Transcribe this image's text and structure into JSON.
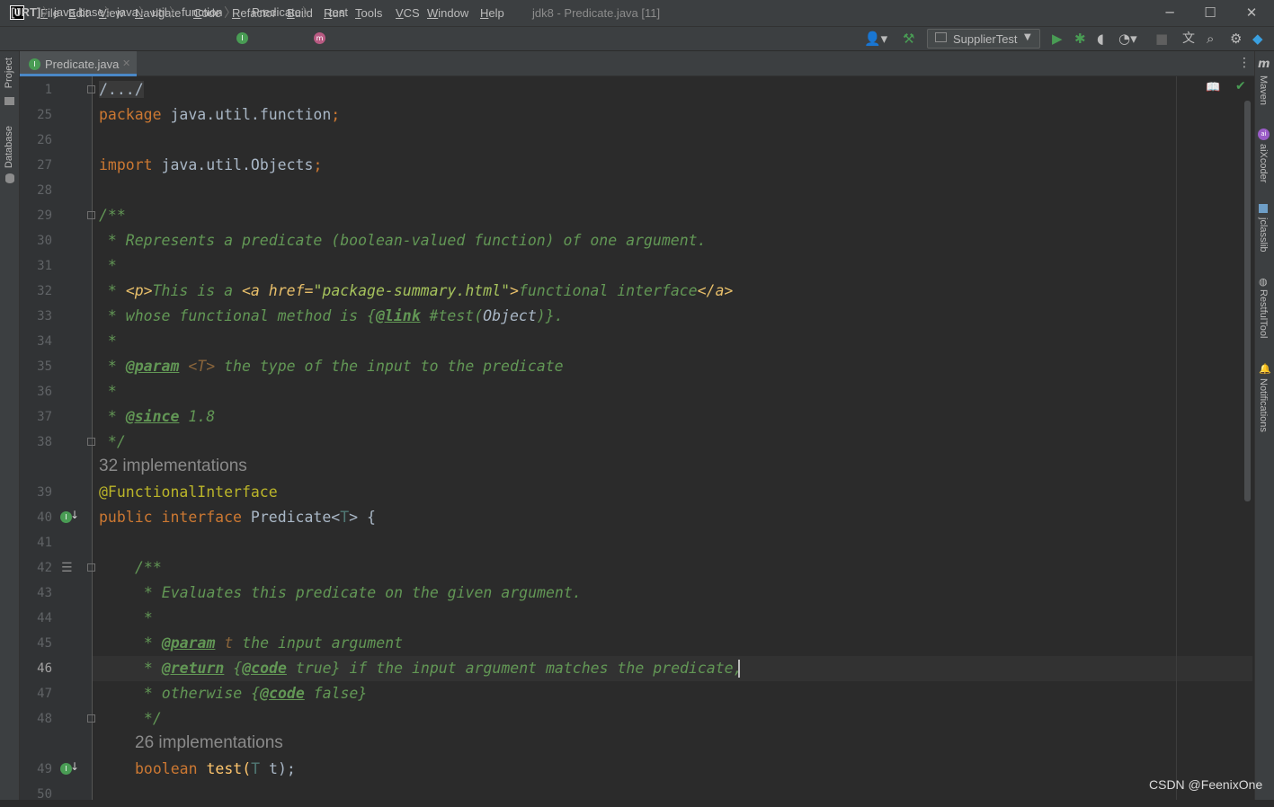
{
  "titlebar": {
    "menus": [
      "File",
      "Edit",
      "View",
      "Navigate",
      "Code",
      "Refactor",
      "Build",
      "Run",
      "Tools",
      "VCS",
      "Window",
      "Help"
    ],
    "window_title": "jdk8 - Predicate.java [11]",
    "minimize": "─",
    "maximize": "☐",
    "close": "✕"
  },
  "navbar": {
    "breadcrumbs": [
      "[JRT]",
      "java.base",
      "java",
      "util",
      "function",
      "Predicate",
      "test"
    ],
    "run_config": "SupplierTest"
  },
  "tool_windows": {
    "left": [
      "Project",
      "Database"
    ],
    "right": [
      "Maven",
      "aiXcoder",
      "jclasslib",
      "RestfulTool",
      "Notifications"
    ]
  },
  "editor": {
    "tab_label": "Predicate.java",
    "line_numbers": [
      "1",
      "25",
      "26",
      "27",
      "28",
      "29",
      "30",
      "31",
      "32",
      "33",
      "34",
      "35",
      "36",
      "37",
      "38",
      "39",
      "40",
      "41",
      "42",
      "43",
      "44",
      "45",
      "46",
      "47",
      "48",
      "49",
      "50"
    ],
    "folded_header": "/.../",
    "code": {
      "package_kw": "package",
      "package_name": "java.util.function",
      "import_kw": "import",
      "import_name": "java.util.Objects",
      "doc_open": "/**",
      "l30": " * Represents a predicate (boolean-valued function) of one argument.",
      "star": " *",
      "l32_prefix": " * ",
      "l32_p": "<p>",
      "l32_text1": "This is a ",
      "l32_a_open": "<a href=",
      "l32_href": "\"package-summary.html\"",
      "l32_gt": ">",
      "l32_text2": "functional interface",
      "l32_a_close": "</a>",
      "l33_prefix": " * whose functional method is {",
      "l33_link": "@link",
      "l33_ref": " #test(",
      "l33_obj": "Object",
      "l33_end": ")}.",
      "l35_prefix": " * ",
      "param_tag": "@param",
      "l35_param": " <T>",
      "l35_text": " the type of the input to the predicate",
      "l37_prefix": " * ",
      "since_tag": "@since",
      "l37_text": " 1.8",
      "doc_close": " */",
      "hint_32": "32 implementations",
      "annotation": "@FunctionalInterface",
      "public_kw": "public",
      "interface_kw": "interface",
      "class_name": " Predicate<",
      "type_param": "T",
      "class_end": "> {",
      "l43": " * Evaluates this predicate on the given argument.",
      "l45_param": " t",
      "l45_text": " the input argument",
      "return_tag": "@return",
      "code_tag": "@code",
      "l46_open": " {",
      "l46_val": " true",
      "l46_text": "} if the input argument matches the predicate",
      "l46_comma": ",",
      "l47_prefix": " * otherwise {",
      "l47_val": " false",
      "l47_end": "}",
      "hint_26": "26 implementations",
      "boolean_kw": "boolean",
      "method_name": " test(",
      "method_param": "T",
      "method_end": " t);"
    }
  },
  "watermark": "CSDN @FeenixOne",
  "colors": {
    "background": "#2b2b2b",
    "keyword": "#cc7832",
    "javadoc": "#629755",
    "annotation": "#bbb529",
    "identifier": "#a9b7c6"
  }
}
